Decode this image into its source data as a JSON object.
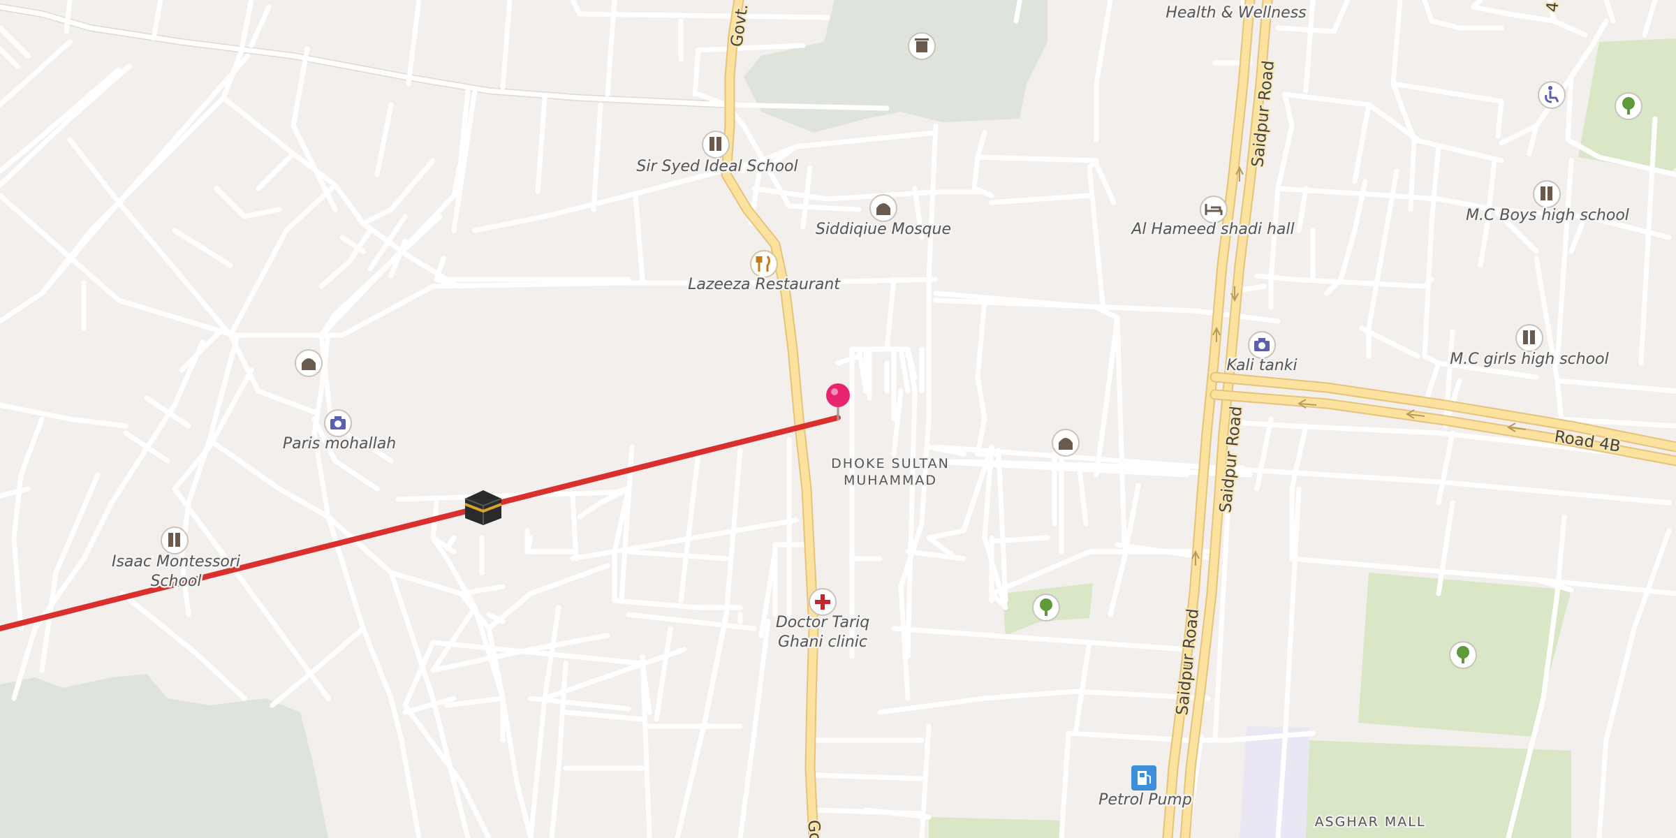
{
  "map": {
    "colors": {
      "land": "#f2efec",
      "park": "#d9e7c6",
      "wood": "#dee3dc",
      "mall": "#ebe6f4",
      "minor_road": "#ffffff",
      "major_road": "#fbe39f",
      "route": "#d9302e",
      "poi": "#6b5a4e",
      "pin": "#e8246e"
    },
    "labels": {
      "health": "Health & Wellness",
      "school_syed": "Sir Syed Ideal School",
      "mosque": "Siddiqiue Mosque",
      "restaurant": "Lazeeza Restaurant",
      "shadi_hall": "Al Hameed shadi hall",
      "mc_boys": "M.C Boys high school",
      "mc_girls": "M.C girls high school",
      "kali_tanki": "Kali tanki",
      "paris": "Paris mohallah",
      "isaac_1": "Isaac Montessori",
      "isaac_2": "School",
      "clinic_1": "Doctor Tariq",
      "clinic_2": "Ghani clinic",
      "petrol": "Petrol Pump",
      "area_1": "DHOKE SULTAN",
      "area_2": "MUHAMMAD",
      "mall": "ASGHAR MALL"
    },
    "roads": {
      "govt_top": "Govt.",
      "govt_bottom": "Go",
      "saidpur_1": "Saidpur Road",
      "saidpur_2": "Saidpur Road",
      "saidpur_3": "Saidpur Road",
      "road_4b": "Road 4B",
      "road_4_top": "4"
    },
    "icons": [
      "school-icon",
      "mosque-icon",
      "restaurant-icon",
      "hotel-icon",
      "camera-icon",
      "tree-icon",
      "clinic-icon",
      "fuel-icon",
      "wheelchair-icon",
      "trash-icon",
      "kaaba-icon",
      "location-pin-icon"
    ]
  }
}
